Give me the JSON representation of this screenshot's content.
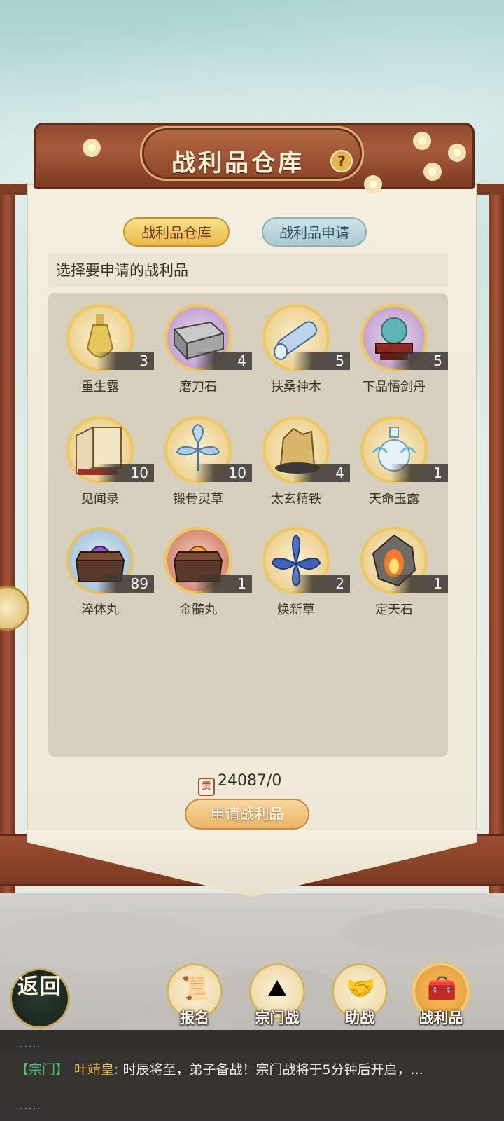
{
  "title": "战利品仓库",
  "help_icon": "question-mark-icon",
  "tabs": [
    {
      "label": "战利品仓库",
      "active": true
    },
    {
      "label": "战利品申请",
      "active": false
    }
  ],
  "prompt": "选择要申请的战利品",
  "items": [
    {
      "name": "重生露",
      "count": "3",
      "icon": "elixir-bottle-icon"
    },
    {
      "name": "磨刀石",
      "count": "4",
      "icon": "whetstone-icon"
    },
    {
      "name": "扶桑神木",
      "count": "5",
      "icon": "divine-wood-icon"
    },
    {
      "name": "下品悟剑丹",
      "count": "5",
      "icon": "sword-pill-icon"
    },
    {
      "name": "见闻录",
      "count": "10",
      "icon": "book-icon"
    },
    {
      "name": "锻骨灵草",
      "count": "10",
      "icon": "spirit-herb-icon"
    },
    {
      "name": "太玄精铁",
      "count": "4",
      "icon": "iron-ore-icon"
    },
    {
      "name": "天命玉露",
      "count": "1",
      "icon": "jade-dew-icon"
    },
    {
      "name": "淬体丸",
      "count": "89",
      "icon": "pill-chest-icon"
    },
    {
      "name": "金髓丸",
      "count": "1",
      "icon": "golden-pill-chest-icon"
    },
    {
      "name": "焕新草",
      "count": "2",
      "icon": "blue-flower-icon"
    },
    {
      "name": "定天石",
      "count": "1",
      "icon": "fire-stone-icon"
    }
  ],
  "currency": {
    "icon": "token-icon",
    "icon_text": "贡",
    "value": "24087/0"
  },
  "apply_button": "申请战利品",
  "back_button": "返回",
  "nav": [
    {
      "label": "报名",
      "icon": "scroll-brush-icon",
      "active": false
    },
    {
      "label": "宗门战",
      "icon": "mountain-flag-icon",
      "active": false
    },
    {
      "label": "助战",
      "icon": "handshake-icon",
      "active": false
    },
    {
      "label": "战利品",
      "icon": "treasure-chest-icon",
      "active": true
    }
  ],
  "chat": {
    "dots_top": "......",
    "channel": "【宗门】",
    "speaker": "叶靖皇:",
    "message": "时辰将至，弟子备战！宗门战将于5分钟后开启，...",
    "dots_bottom": "......"
  },
  "colors": {
    "accent": "#e8b94a",
    "frame": "#8e4a30",
    "paper": "#f3eee0"
  }
}
